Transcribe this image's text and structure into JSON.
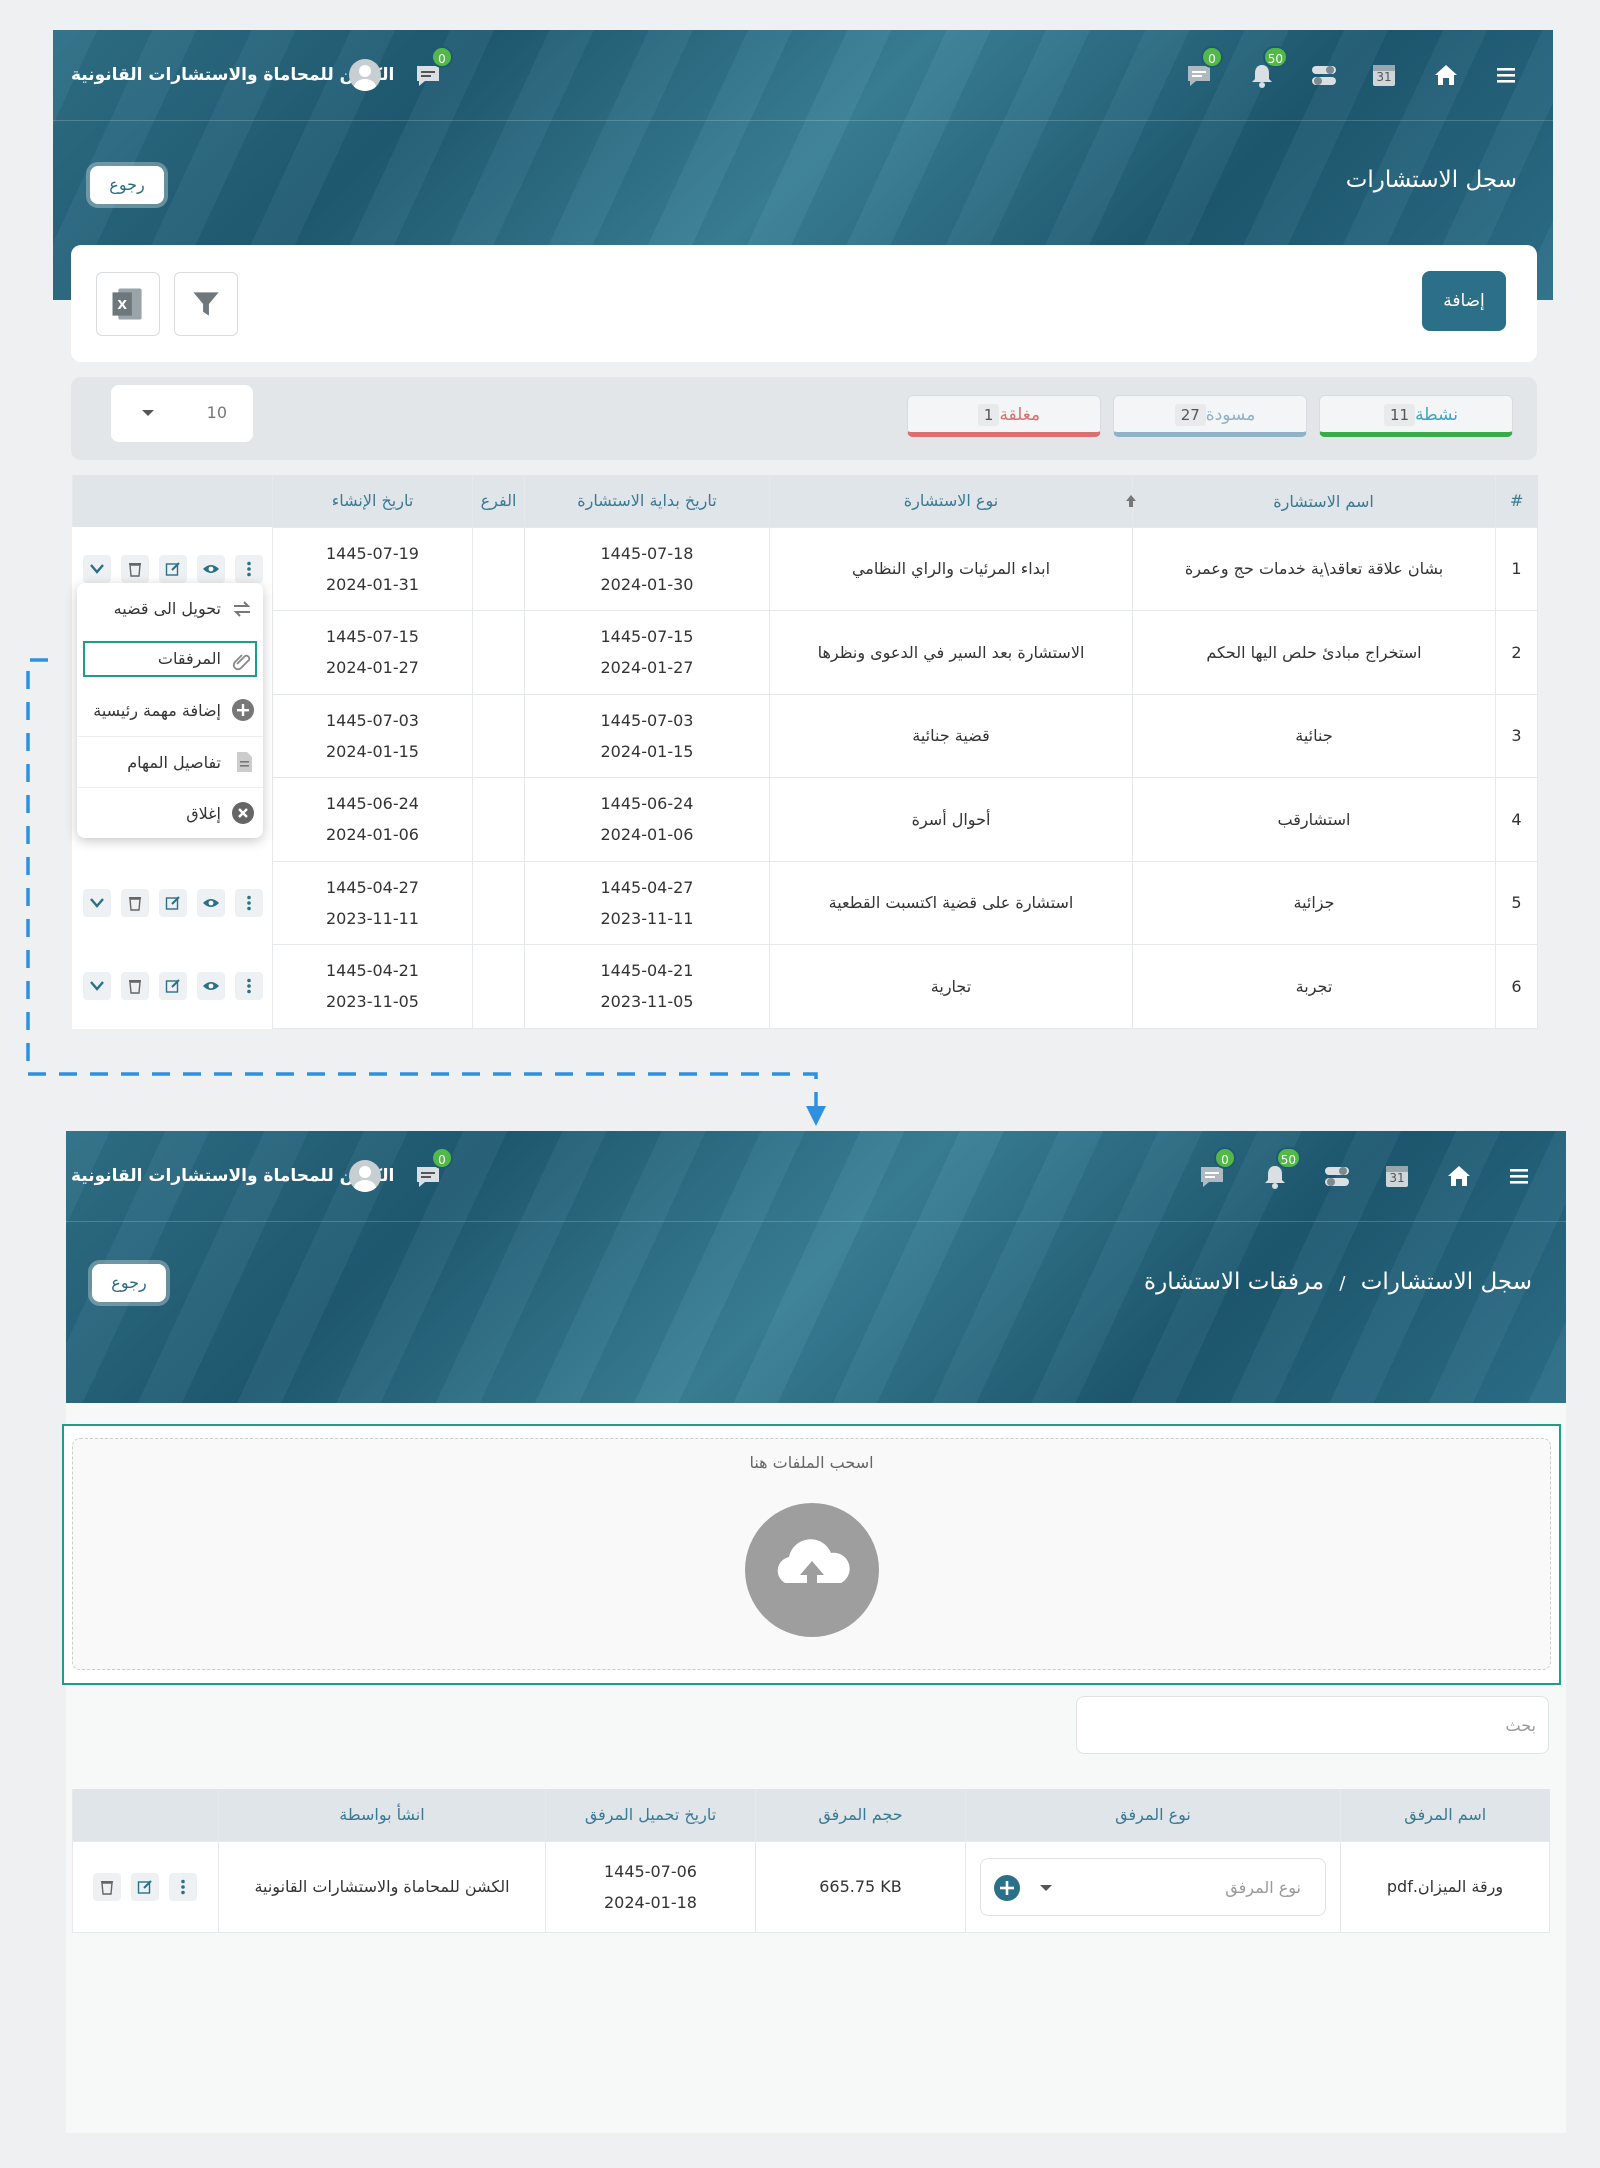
{
  "navbar": {
    "brand": "الكشن للمحاماة والاستشارات القانونية",
    "messages_badge": "0",
    "chat_badge": "0",
    "notifications_badge": "50",
    "calendar_day": "31"
  },
  "screen1": {
    "title": "سجل الاستشارات",
    "back_label": "رجوع",
    "add_label": "إضافة",
    "tabs": [
      {
        "label": "نشطة",
        "count": "11",
        "color": "#3aab4a"
      },
      {
        "label": "مسودة",
        "count": "27",
        "color": "#8fb2c8"
      },
      {
        "label": "مغلقة",
        "count": "1",
        "color": "#d9706f"
      }
    ],
    "page_size": "10",
    "columns": [
      "#",
      "اسم الاستشارة",
      "نوع الاستشارة",
      "تاريخ بداية الاستشارة",
      "الفرع",
      "تاريخ الإنشاء"
    ],
    "rows": [
      {
        "num": "1",
        "name": "بشان علاقة تعاقد\\ية خدمات حج وعمرة",
        "type": "ابداء المرئيات والراي النظامي",
        "start_h": "1445-07-18",
        "start_g": "2024-01-30",
        "branch": "",
        "created_h": "1445-07-19",
        "created_g": "2024-01-31"
      },
      {
        "num": "2",
        "name": "استخراج مبادئ حلص اليها الحكم",
        "type": "الاستشارة بعد السير في الدعوى ونظرها",
        "start_h": "1445-07-15",
        "start_g": "2024-01-27",
        "branch": "",
        "created_h": "1445-07-15",
        "created_g": "2024-01-27"
      },
      {
        "num": "3",
        "name": "جنائية",
        "type": "قضية جنائية",
        "start_h": "1445-07-03",
        "start_g": "2024-01-15",
        "branch": "",
        "created_h": "1445-07-03",
        "created_g": "2024-01-15"
      },
      {
        "num": "4",
        "name": "استشارقب",
        "type": "أحوال أسرة",
        "start_h": "1445-06-24",
        "start_g": "2024-01-06",
        "branch": "",
        "created_h": "1445-06-24",
        "created_g": "2024-01-06"
      },
      {
        "num": "5",
        "name": "جزائية",
        "type": "استشارة على قضية اكتسبت القطعية",
        "start_h": "1445-04-27",
        "start_g": "2023-11-11",
        "branch": "",
        "created_h": "1445-04-27",
        "created_g": "2023-11-11"
      },
      {
        "num": "6",
        "name": "تجربة",
        "type": "تجارية",
        "start_h": "1445-04-21",
        "start_g": "2023-11-05",
        "branch": "",
        "created_h": "1445-04-21",
        "created_g": "2023-11-05"
      }
    ],
    "context_menu": [
      {
        "label": "تحويل الى قضيه",
        "icon": "convert-icon"
      },
      {
        "label": "المرفقات",
        "icon": "paperclip-icon"
      },
      {
        "label": "إضافة مهمة رئيسية",
        "icon": "plus-circle-icon"
      },
      {
        "label": "تفاصيل المهام",
        "icon": "document-icon"
      },
      {
        "label": "إغلاق",
        "icon": "close-circle-icon"
      }
    ]
  },
  "screen2": {
    "breadcrumb_root": "سجل الاستشارات",
    "breadcrumb_sep": "/",
    "breadcrumb_current": "مرفقات الاستشارة",
    "back_label": "رجوع",
    "dropzone_label": "اسحب الملفات هنا",
    "search_placeholder": "بحث",
    "columns": [
      "اسم المرفق",
      "نوع المرفق",
      "حجم المرفق",
      "تاريخ تحميل المرفق",
      "انشأ بواسطة"
    ],
    "rows": [
      {
        "name": "ورقة الميزان.pdf",
        "type_placeholder": "نوع المرفق",
        "size": "665.75 KB",
        "date_h": "1445-07-06",
        "date_g": "2024-01-18",
        "created_by": "الكشن للمحاماة والاستشارات القانونية"
      }
    ]
  },
  "colors": {
    "primary": "#2b7088",
    "link": "#3fa4c4",
    "highlight": "#1e9e86",
    "connector": "#2f8fe0",
    "badge": "#52b848"
  }
}
